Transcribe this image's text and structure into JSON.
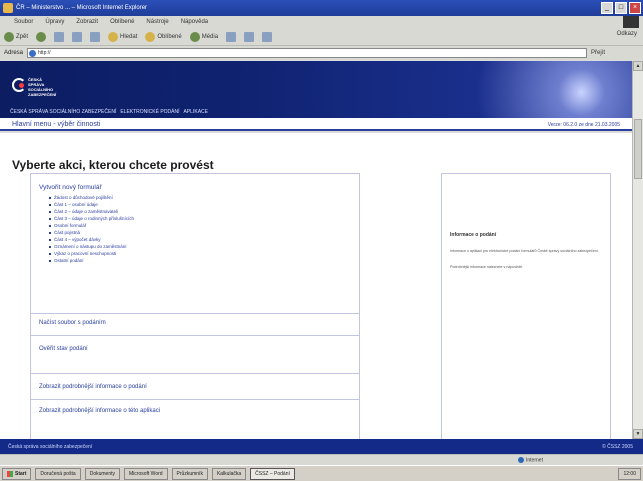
{
  "window": {
    "title": "ČR – Ministerstvo ... – Microsoft Internet Explorer",
    "controls": [
      "_",
      "□",
      "×"
    ]
  },
  "menubar": {
    "items": [
      "Soubor",
      "Úpravy",
      "Zobrazit",
      "Oblíbené",
      "Nástroje",
      "Nápověda"
    ]
  },
  "toolbar": {
    "back_label": "Zpět",
    "hledat_label": "Hledat",
    "oblibene_label": "Oblíbené",
    "media_label": "Média",
    "odkazy_label": "Odkazy"
  },
  "address": {
    "label": "Adresa",
    "url": "http://",
    "go_label": "Přejít"
  },
  "banner": {
    "logo_text": "ČESKÁ SPRÁVA SOCIÁLNÍHO ZABEZPEČENÍ",
    "nav": [
      "ČESKÁ SPRÁVA SOCIÁLNÍHO ZABEZPEČENÍ",
      "ELEKTRONICKÉ PODÁNÍ",
      "APLIKACE"
    ]
  },
  "breadcrumb": "Hlavní menu - výběr činnosti",
  "version": "Verze: 06.2.0 ze dne 21.03.2005",
  "page_title": "Vyberte akci, kterou chcete provést",
  "sections": {
    "sec1_title": "Vytvořit nový formulář",
    "sec1_items": [
      "Žádost o důchodové pojištění",
      "Část 1 – osobní údaje",
      "Část 2 – údaje o zaměstnavateli",
      "Část 3 – údaje o rodinných příslušnících",
      "Osobní formulář",
      "Část pojistná",
      "Část 4 – výpočet dávky",
      "Oznámení o nástupu do zaměstnání",
      "Výkaz o pracovní neschopnosti",
      "Ostatní podání"
    ],
    "sec2_title": "Načíst soubor s podáním",
    "sec3_title": "Ověřit stav podání",
    "sec4_title": "Zobrazit podrobnější informace o podání",
    "sec5_title": "Zobrazit podrobnější informace o této aplikaci"
  },
  "sidebar": {
    "title": "Informace o podání",
    "paragraph1": "Informace o aplikaci pro elektronické podání formulářů České správy sociálního zabezpečení.",
    "paragraph2": "Podrobnější informace naleznete v nápovědě."
  },
  "footer": {
    "left": "Česká správa sociálního zabezpečení",
    "right": "© ČSSZ 2005"
  },
  "statusbar": {
    "zone": "Internet"
  },
  "taskbar": {
    "start": "Start",
    "tasks": [
      "Doručená pošta",
      "Dokumenty",
      "Microsoft Word",
      "Průzkumník",
      "Kalkulačka",
      "ČSSZ – Podání"
    ],
    "tray": "12:00"
  }
}
